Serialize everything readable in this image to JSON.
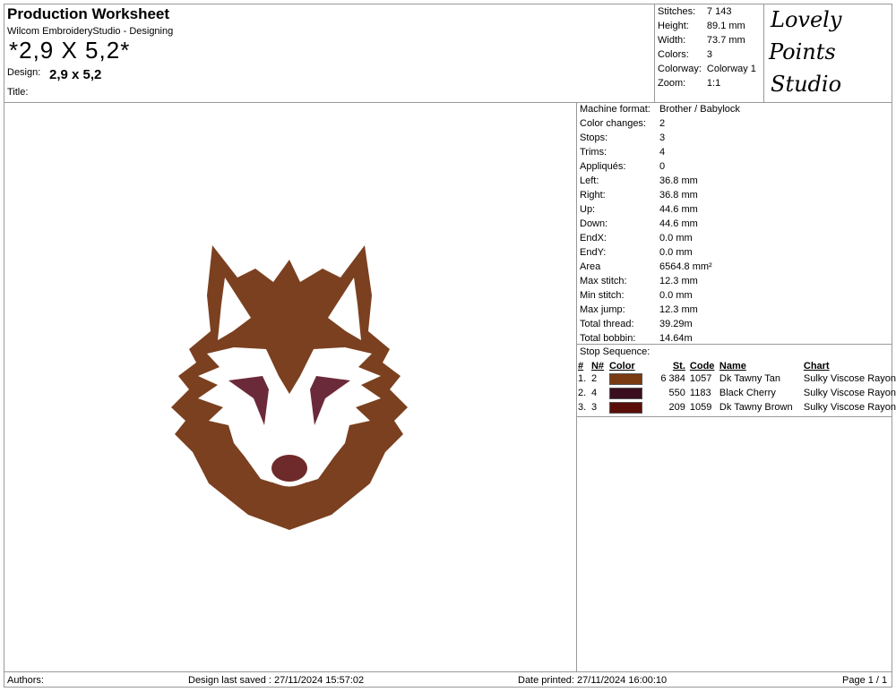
{
  "header": {
    "title": "Production Worksheet",
    "subtitle": "Wilcom EmbroideryStudio - Designing",
    "design_big": "*2,9 X 5,2*",
    "design_label": "Design:",
    "design_value": "2,9 x 5,2",
    "title_label": "Title:"
  },
  "summary": [
    {
      "label": "Stitches:",
      "value": "7 143"
    },
    {
      "label": "Height:",
      "value": "89.1 mm"
    },
    {
      "label": "Width:",
      "value": "73.7 mm"
    },
    {
      "label": "Colors:",
      "value": "3"
    },
    {
      "label": "Colorway:",
      "value": "Colorway 1"
    },
    {
      "label": "Zoom:",
      "value": "1:1"
    }
  ],
  "logo": {
    "line1": "Lovely",
    "line2": "Points",
    "line3": "Studio"
  },
  "details": [
    {
      "label": "Machine format:",
      "value": "Brother / Babylock"
    },
    {
      "label": "Color changes:",
      "value": "2"
    },
    {
      "label": "Stops:",
      "value": "3"
    },
    {
      "label": "Trims:",
      "value": "4"
    },
    {
      "label": "Appliqués:",
      "value": "0"
    },
    {
      "label": "Left:",
      "value": "36.8 mm"
    },
    {
      "label": "Right:",
      "value": "36.8 mm"
    },
    {
      "label": "Up:",
      "value": "44.6 mm"
    },
    {
      "label": "Down:",
      "value": "44.6 mm"
    },
    {
      "label": "EndX:",
      "value": "0.0 mm"
    },
    {
      "label": "EndY:",
      "value": "0.0 mm"
    },
    {
      "label": "Area",
      "value": "6564.8 mm²"
    },
    {
      "label": "Max stitch:",
      "value": "12.3 mm"
    },
    {
      "label": "Min stitch:",
      "value": "0.0 mm"
    },
    {
      "label": "Max jump:",
      "value": "12.3 mm"
    },
    {
      "label": "Total thread:",
      "value": "39.29m"
    },
    {
      "label": "Total bobbin:",
      "value": "14.64m"
    }
  ],
  "stop_sequence": {
    "title": "Stop Sequence:",
    "headers": {
      "num": "#",
      "n": "N#",
      "color": "Color",
      "st": "St.",
      "code": "Code",
      "name": "Name",
      "chart": "Chart"
    },
    "rows": [
      {
        "num": "1.",
        "n": "2",
        "color": "#7a3a12",
        "st": "6 384",
        "code": "1057",
        "name": "Dk Tawny Tan",
        "chart": "Sulky Viscose Rayon"
      },
      {
        "num": "2.",
        "n": "4",
        "color": "#3a0e1e",
        "st": "550",
        "code": "1183",
        "name": "Black Cherry",
        "chart": "Sulky Viscose Rayon"
      },
      {
        "num": "3.",
        "n": "3",
        "color": "#5a0e0a",
        "st": "209",
        "code": "1059",
        "name": "Dk Tawny Brown",
        "chart": "Sulky Viscose Rayon"
      }
    ]
  },
  "footer": {
    "authors": "Authors:",
    "saved": "Design last saved : 27/11/2024 15:57:02",
    "printed": "Date printed: 27/11/2024 16:00:10",
    "page": "Page 1 / 1"
  },
  "colors": {
    "fur": "#7b4020",
    "eye": "#6b2a3a",
    "nose": "#6e2a2a",
    "border": "#999999"
  }
}
